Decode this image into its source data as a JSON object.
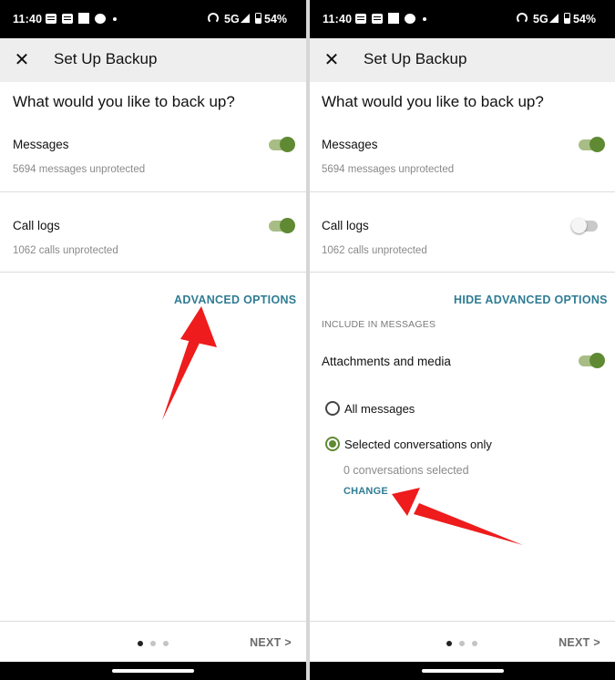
{
  "status_bar": {
    "time": "11:40",
    "network": "5G",
    "battery": "54%"
  },
  "app_bar": {
    "title": "Set Up Backup"
  },
  "question": "What would you like to back up?",
  "left_screen": {
    "messages": {
      "label": "Messages",
      "sub": "5694 messages unprotected",
      "enabled": true
    },
    "call_logs": {
      "label": "Call logs",
      "sub": "1062 calls unprotected",
      "enabled": true
    },
    "advanced_options_label": "ADVANCED OPTIONS"
  },
  "right_screen": {
    "messages": {
      "label": "Messages",
      "sub": "5694 messages unprotected",
      "enabled": true
    },
    "call_logs": {
      "label": "Call logs",
      "sub": "1062 calls unprotected",
      "enabled": false
    },
    "hide_advanced_label": "HIDE ADVANCED OPTIONS",
    "include_caption": "INCLUDE IN MESSAGES",
    "attachments": {
      "label": "Attachments and media",
      "enabled": true
    },
    "radio_options": [
      {
        "label": "All messages",
        "selected": false
      },
      {
        "label": "Selected conversations only",
        "selected": true
      }
    ],
    "conversations_selected": "0 conversations selected",
    "change_label": "CHANGE"
  },
  "bottom_nav": {
    "next_label": "NEXT >",
    "pages": 3,
    "current_page": 1
  },
  "colors": {
    "accent_green": "#5f8a33",
    "link_teal": "#2f7c93",
    "annotation_red": "#ee1c1c"
  }
}
